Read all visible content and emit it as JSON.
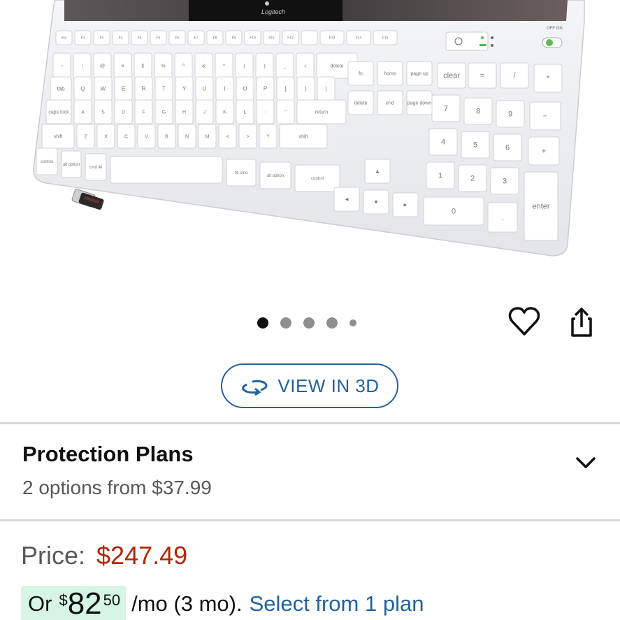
{
  "product_image": {
    "brand_logo_text": "Logitech",
    "switch_label": "OFF ON",
    "keys": {
      "fn_row": [
        "esc",
        "F1",
        "F2",
        "F3",
        "F4",
        "F5",
        "F6",
        "F7",
        "F8",
        "F9",
        "F10",
        "F11",
        "F12",
        "",
        "F13",
        "F14",
        "F15"
      ],
      "num_row": [
        "~",
        "!",
        "@",
        "#",
        "$",
        "%",
        "^",
        "&",
        "*",
        "(",
        ")",
        "_",
        "+",
        "delete"
      ],
      "q_row": [
        "tab",
        "Q",
        "W",
        "E",
        "R",
        "T",
        "Y",
        "U",
        "I",
        "O",
        "P",
        "{",
        "}",
        "|"
      ],
      "a_row": [
        "caps lock",
        "A",
        "S",
        "D",
        "F",
        "G",
        "H",
        "J",
        "K",
        "L",
        ":",
        "\"",
        "return"
      ],
      "z_row": [
        "shift",
        "Z",
        "X",
        "C",
        "V",
        "B",
        "N",
        "M",
        "<",
        ">",
        "?",
        "shift"
      ],
      "bottom_row": [
        "control",
        "alt option",
        "cmd ⌘",
        "",
        "⌘ cmd",
        "alt option",
        "control"
      ],
      "nav": [
        "fn",
        "home",
        "page up",
        "delete",
        "end",
        "page down"
      ],
      "numpad": [
        "clear",
        "=",
        "/",
        "*",
        "7",
        "8",
        "9",
        "−",
        "4",
        "5",
        "6",
        "+",
        "1",
        "2",
        "3",
        "0",
        ".",
        "enter"
      ]
    }
  },
  "carousel": {
    "count": 5,
    "active_index": 0
  },
  "view_3d": {
    "label": "VIEW IN 3D"
  },
  "protection": {
    "title": "Protection Plans",
    "subtitle": "2 options from $37.99"
  },
  "price": {
    "label": "Price:",
    "value": "$247.49"
  },
  "monthly": {
    "prefix": "Or",
    "symbol": "$",
    "whole": "82",
    "fraction": "50",
    "term": "/mo (3 mo).",
    "link": "Select from 1 plan"
  },
  "icons": {
    "wishlist": "heart-icon",
    "share": "share-icon",
    "view3d": "rotate-3d-icon",
    "expand": "chevron-down-icon"
  },
  "colors": {
    "link": "#2162a1",
    "price": "#b12704",
    "badge": "#d6f5e4",
    "divider": "#d5d9d9"
  }
}
